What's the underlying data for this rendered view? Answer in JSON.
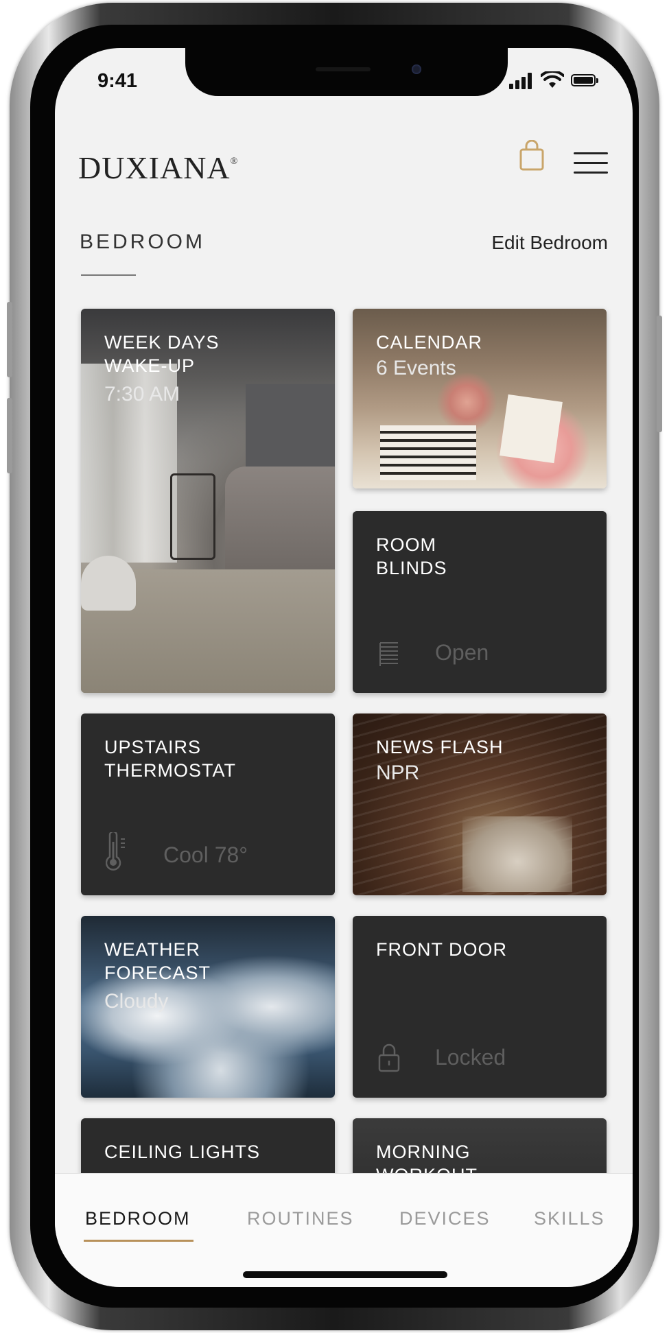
{
  "status_bar": {
    "time": "9:41"
  },
  "header": {
    "logo": "DUXIANA",
    "logo_mark": "®",
    "icons": [
      "shopping-bag-icon",
      "hamburger-menu-icon"
    ],
    "accent_color": "#c9a56a"
  },
  "section": {
    "title": "BEDROOM",
    "edit_label": "Edit Bedroom"
  },
  "tiles": {
    "wakeup": {
      "title": "WEEK DAYS\nWAKE-UP",
      "subtitle": "7:30 AM"
    },
    "calendar": {
      "title": "CALENDAR",
      "subtitle": "6 Events"
    },
    "blinds": {
      "title": "ROOM\nBLINDS",
      "status": "Open",
      "icon": "blinds-icon"
    },
    "thermostat": {
      "title": "UPSTAIRS\nTHERMOSTAT",
      "status": "Cool 78°",
      "icon": "thermometer-icon"
    },
    "news": {
      "title": "NEWS FLASH",
      "subtitle": "NPR"
    },
    "weather": {
      "title": "WEATHER\nFORECAST",
      "subtitle": "Cloudy"
    },
    "door": {
      "title": "FRONT DOOR",
      "status": "Locked",
      "icon": "lock-icon"
    },
    "lights": {
      "title": "CEILING LIGHTS"
    },
    "workout": {
      "title": "MORNING\nWORKOUT"
    }
  },
  "bottom_nav": {
    "items": [
      "BEDROOM",
      "ROUTINES",
      "DEVICES",
      "SKILLS"
    ],
    "active": "BEDROOM",
    "active_color": "#b8915a"
  }
}
